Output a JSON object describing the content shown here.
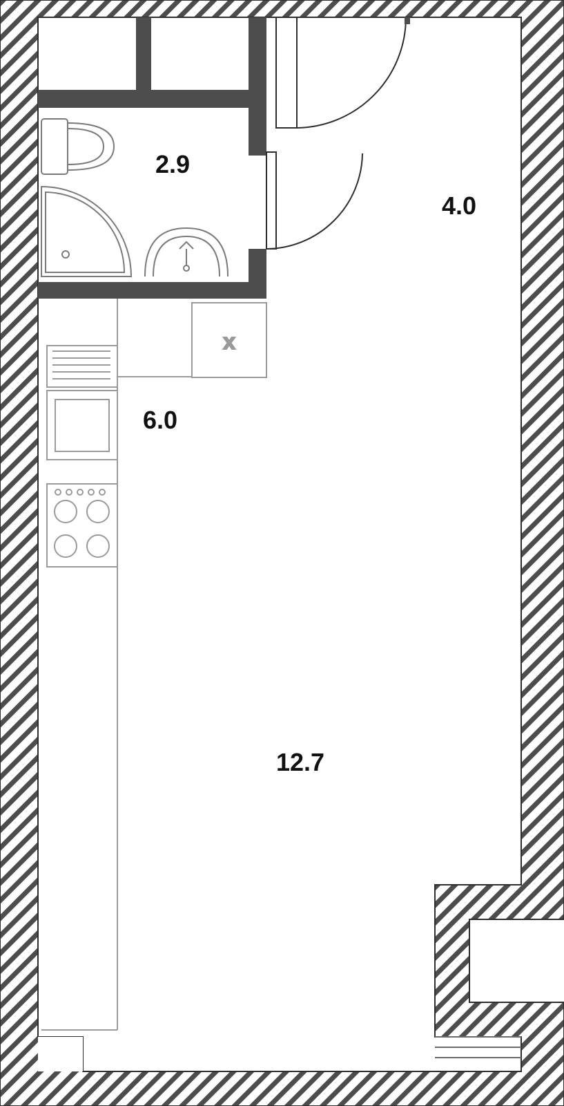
{
  "floorplan": {
    "rooms": {
      "bathroom": {
        "area": "2.9"
      },
      "hall": {
        "area": "4.0"
      },
      "kitchen": {
        "area": "6.0"
      },
      "living": {
        "area": "12.7"
      }
    },
    "sink_marker": "x"
  }
}
